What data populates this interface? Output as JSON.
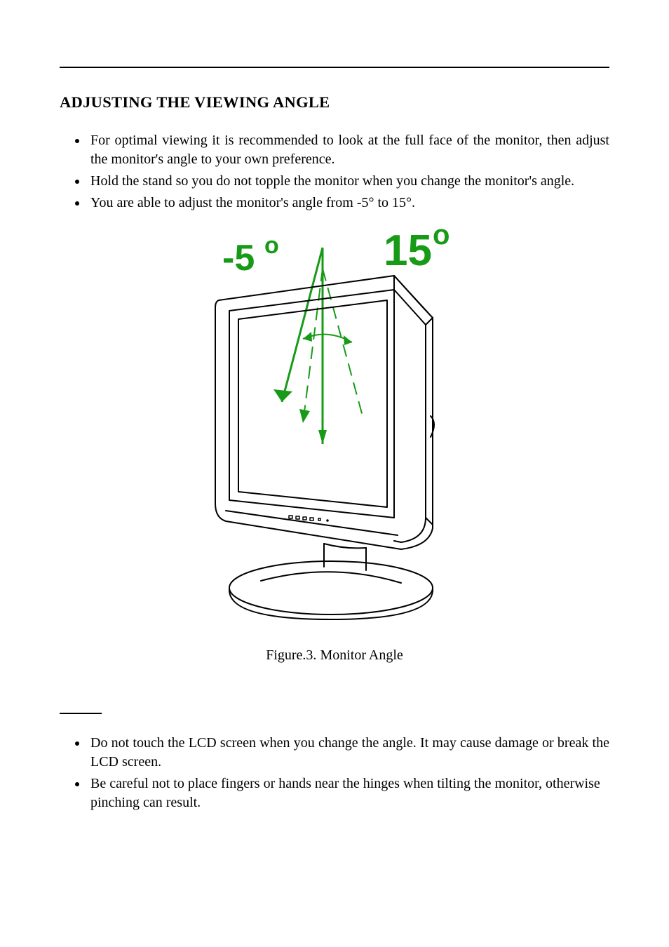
{
  "heading": "ADJUSTING THE VIEWING ANGLE",
  "bullets": [
    "For optimal viewing it is recommended to look at the full face of the monitor, then adjust the monitor's angle to your own preference.",
    "Hold the stand so you do not topple the monitor when you change the monitor's angle.",
    "You are able to adjust the monitor's angle from -5° to 15°."
  ],
  "figure": {
    "label_neg": "-5",
    "label_neg_sup": "o",
    "label_pos": "15",
    "label_pos_sup": "o",
    "caption_prefix": "Figure.3.",
    "caption_text": " Monitor Angle"
  },
  "notes": [
    "Do not touch the LCD screen when you change the angle. It may cause damage or break the LCD screen.",
    "Be careful not to place fingers or hands near the hinges when tilting the monitor, otherwise pinching can result."
  ]
}
